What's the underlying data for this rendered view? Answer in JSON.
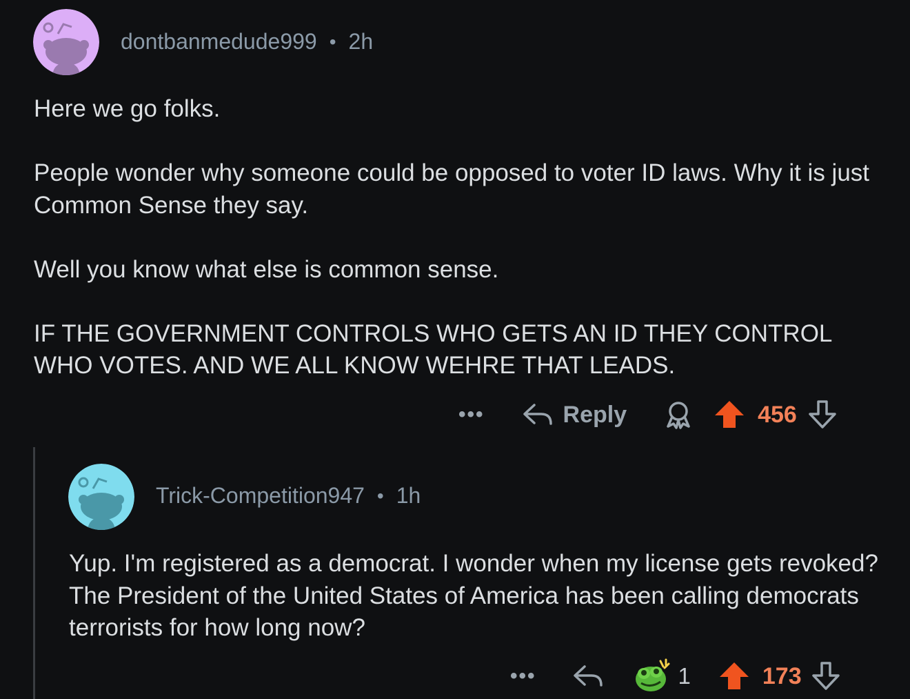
{
  "comments": [
    {
      "username": "dontbanmedude999",
      "separator": "•",
      "time": "2h",
      "avatar_color": "#dcaef7",
      "avatar_figure_color": "#9a7aaf",
      "body": "Here we go folks.\n\nPeople wonder why someone could be opposed to voter ID laws. Why it is just Common Sense they say.\n\nWell you know what else is common sense.\n\nIF THE GOVERNMENT CONTROLS WHO GETS AN ID THEY CONTROL WHO VOTES. AND WE ALL KNOW WEHRE THAT LEADS.",
      "actions": {
        "more": "•••",
        "reply_label": "Reply",
        "award_icon": "award-icon",
        "score": "456"
      }
    },
    {
      "username": "Trick-Competition947",
      "separator": "•",
      "time": "1h",
      "avatar_color": "#7fdcee",
      "avatar_figure_color": "#4a98a8",
      "body": "Yup. I'm registered as a democrat. I wonder when my license gets revoked? The President of the United States of America has been calling democrats terrorists for how long now?",
      "actions": {
        "more": "•••",
        "award_icon": "frog-award-icon",
        "award_count": "1",
        "score": "173"
      }
    }
  ],
  "colors": {
    "background": "#0f1012",
    "upvote_active": "#f0541f",
    "score_active": "#f28158",
    "muted": "#8b9aa8"
  }
}
